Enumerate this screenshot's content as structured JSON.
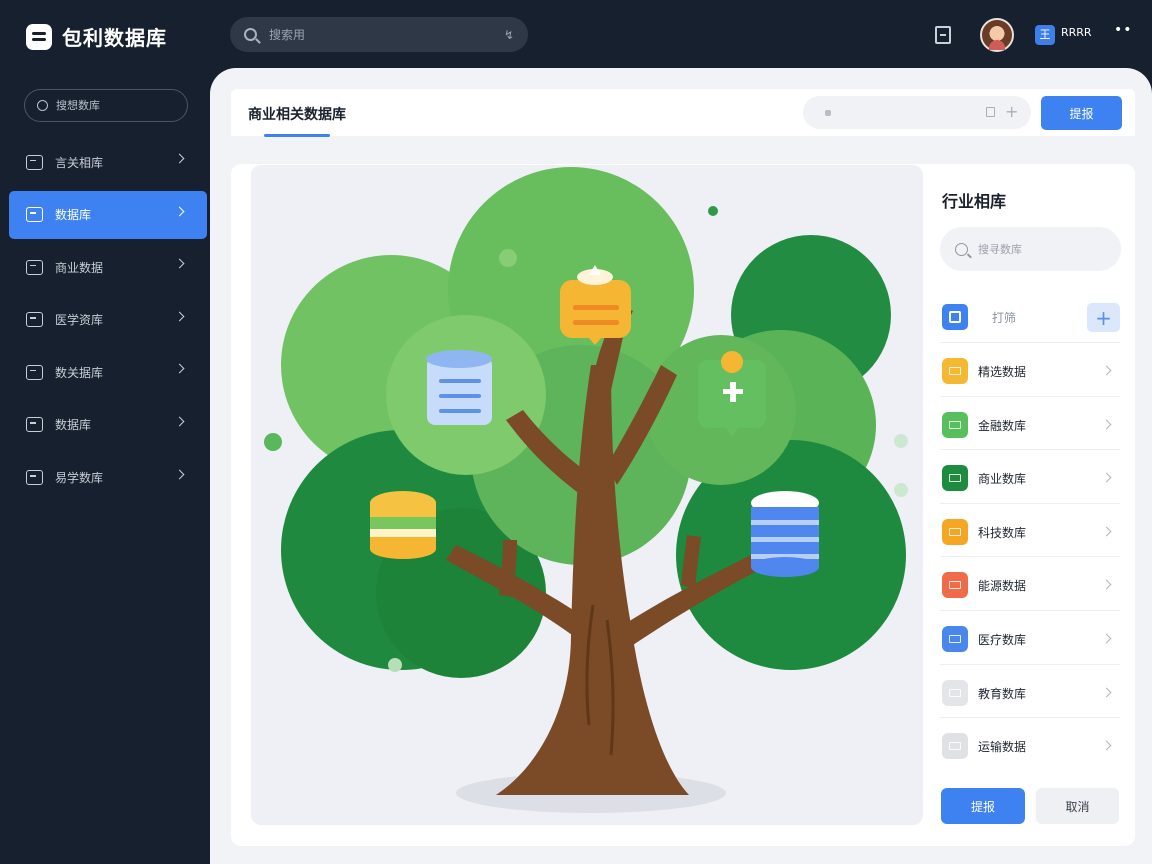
{
  "app": {
    "title": "包利数据库"
  },
  "top_search": {
    "placeholder": "搜索用",
    "voice_glyph": "↯"
  },
  "user": {
    "badge_glyph": "王",
    "name": "RRRR",
    "more_glyph": "••"
  },
  "sidebar": {
    "search_placeholder": "搜想数库",
    "items": [
      {
        "label": "言关相库",
        "icon": "building-icon",
        "active": false
      },
      {
        "label": "数据库",
        "icon": "database-icon",
        "active": true
      },
      {
        "label": "商业数据",
        "icon": "wallet-icon",
        "active": false
      },
      {
        "label": "医学资库",
        "icon": "medical-icon",
        "active": false
      },
      {
        "label": "数关据库",
        "icon": "card-icon",
        "active": false
      },
      {
        "label": "数据库",
        "icon": "monitor-icon",
        "active": false
      },
      {
        "label": "易学数库",
        "icon": "briefcase-icon",
        "active": false
      }
    ]
  },
  "header": {
    "tab_label": "商业相关数据库",
    "button_label": "提报",
    "plus_glyph": "+"
  },
  "right_panel": {
    "title": "行业相库",
    "search_placeholder": "搜寻数库",
    "filter_label": "打筛",
    "add_glyph": "+",
    "items": [
      {
        "label": "精选数据",
        "color": "#f5b833"
      },
      {
        "label": "金融数库",
        "color": "#57bf5b"
      },
      {
        "label": "商业数库",
        "color": "#1e8c3f"
      },
      {
        "label": "科技数库",
        "color": "#f5a623"
      },
      {
        "label": "能源数据",
        "color": "#ef6b4a"
      },
      {
        "label": "医疗数库",
        "color": "#4a87ec"
      },
      {
        "label": "教育数库",
        "color": "#e3e5e9"
      },
      {
        "label": "运输数据",
        "color": "#dfe1e5"
      }
    ],
    "primary_button": "提报",
    "secondary_button": "取消"
  },
  "colors": {
    "accent": "#3d82f0",
    "sidebar_bg": "#17202e",
    "tree_trunk": "#7b4a26",
    "leaf_light": "#72c463",
    "leaf_dark": "#1f8a3f"
  }
}
